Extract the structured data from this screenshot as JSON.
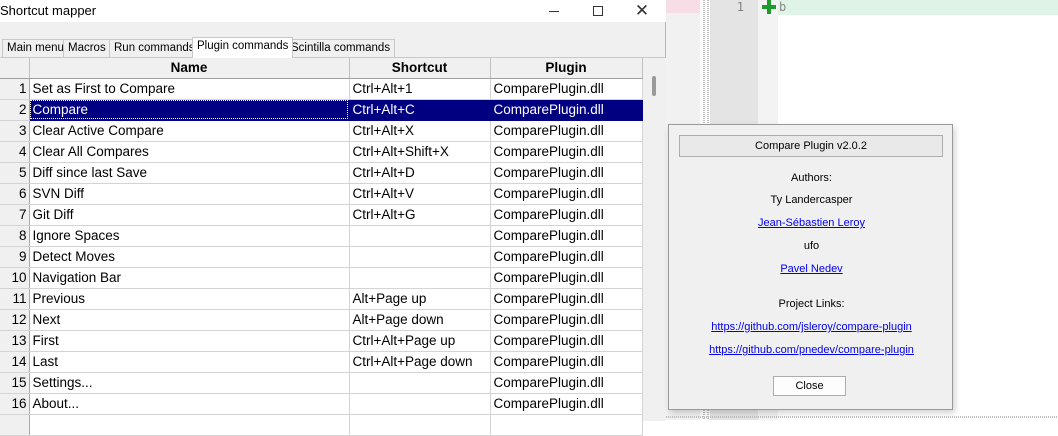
{
  "window": {
    "title": "Shortcut mapper"
  },
  "tabs": [
    "Main menu",
    "Macros",
    "Run commands",
    "Plugin commands",
    "Scintilla commands"
  ],
  "active_tab": "Plugin commands",
  "table": {
    "columns": [
      "Name",
      "Shortcut",
      "Plugin"
    ],
    "selected_row": 2,
    "rows": [
      {
        "num": "1",
        "name": "Set as First to Compare",
        "shortcut": "Ctrl+Alt+1",
        "plugin": "ComparePlugin.dll"
      },
      {
        "num": "2",
        "name": "Compare",
        "shortcut": "Ctrl+Alt+C",
        "plugin": "ComparePlugin.dll"
      },
      {
        "num": "3",
        "name": "Clear Active Compare",
        "shortcut": "Ctrl+Alt+X",
        "plugin": "ComparePlugin.dll"
      },
      {
        "num": "4",
        "name": "Clear All Compares",
        "shortcut": "Ctrl+Alt+Shift+X",
        "plugin": "ComparePlugin.dll"
      },
      {
        "num": "5",
        "name": "Diff since last Save",
        "shortcut": "Ctrl+Alt+D",
        "plugin": "ComparePlugin.dll"
      },
      {
        "num": "6",
        "name": "SVN Diff",
        "shortcut": "Ctrl+Alt+V",
        "plugin": "ComparePlugin.dll"
      },
      {
        "num": "7",
        "name": "Git Diff",
        "shortcut": "Ctrl+Alt+G",
        "plugin": "ComparePlugin.dll"
      },
      {
        "num": "8",
        "name": "Ignore Spaces",
        "shortcut": "",
        "plugin": "ComparePlugin.dll"
      },
      {
        "num": "9",
        "name": "Detect Moves",
        "shortcut": "",
        "plugin": "ComparePlugin.dll"
      },
      {
        "num": "10",
        "name": "Navigation Bar",
        "shortcut": "",
        "plugin": "ComparePlugin.dll"
      },
      {
        "num": "11",
        "name": "Previous",
        "shortcut": "Alt+Page up",
        "plugin": "ComparePlugin.dll"
      },
      {
        "num": "12",
        "name": "Next",
        "shortcut": "Alt+Page down",
        "plugin": "ComparePlugin.dll"
      },
      {
        "num": "13",
        "name": "First",
        "shortcut": "Ctrl+Alt+Page up",
        "plugin": "ComparePlugin.dll"
      },
      {
        "num": "14",
        "name": "Last",
        "shortcut": "Ctrl+Alt+Page down",
        "plugin": "ComparePlugin.dll"
      },
      {
        "num": "15",
        "name": "Settings...",
        "shortcut": "",
        "plugin": "ComparePlugin.dll"
      },
      {
        "num": "16",
        "name": "About...",
        "shortcut": "",
        "plugin": "ComparePlugin.dll"
      },
      {
        "num": "",
        "name": "",
        "shortcut": "",
        "plugin": ""
      }
    ]
  },
  "editor": {
    "line_number": "1",
    "code": "b",
    "added_marker": "plus-icon"
  },
  "about_dialog": {
    "title_button": "Compare Plugin v2.0.2",
    "authors_label": "Authors:",
    "authors": [
      {
        "name": "Ty Landercasper",
        "link": false
      },
      {
        "name": "Jean-Sébastien Leroy",
        "link": true
      },
      {
        "name": "ufo",
        "link": false
      },
      {
        "name": "Pavel Nedev",
        "link": true
      }
    ],
    "links_label": "Project Links:",
    "links": [
      "https://github.com/jsleroy/compare-plugin",
      "https://github.com/pnedev/compare-plugin"
    ],
    "close_label": "Close"
  },
  "colors": {
    "selection": "#000080",
    "link": "#0000ee",
    "added_line": "#dff3e6",
    "plus": "#1e9b2f"
  }
}
